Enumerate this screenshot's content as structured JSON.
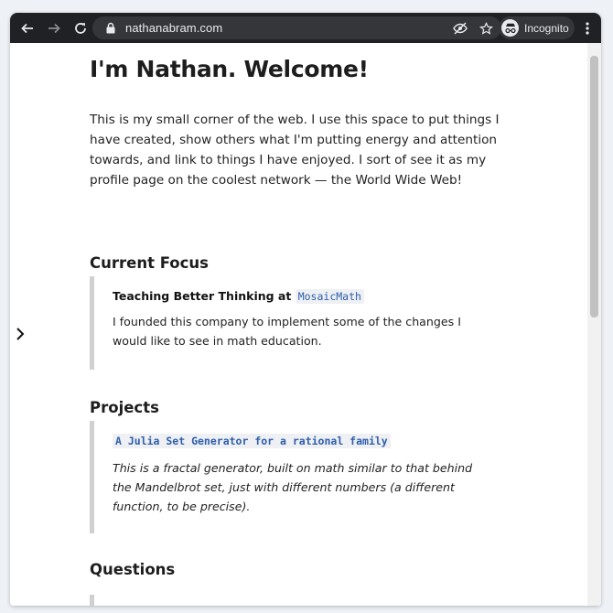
{
  "browser": {
    "url": "nathanabram.com",
    "profile_label": "Incognito"
  },
  "page": {
    "title": "I'm Nathan. Welcome!",
    "intro": "This is my small corner of the web. I use this space to put things I have created, show others what I'm putting energy and attention towards, and link to things I have enjoyed. I sort of see it as my profile page on the coolest network — the World Wide Web!",
    "current_focus": {
      "heading": "Current Focus",
      "item_title_prefix": "Teaching Better Thinking at",
      "item_link": "MosaicMath",
      "item_text": "I founded this company to implement some of the changes I would like to see in math education."
    },
    "projects": {
      "heading": "Projects",
      "item_link": "A Julia Set Generator for a rational family",
      "item_text": "This is a fractal generator, built on math similar to that behind the Mandelbrot set, just with different numbers (a different function, to be precise)."
    },
    "questions": {
      "heading": "Questions"
    }
  },
  "colors": {
    "toolbar": "#202124",
    "omnibox": "#35363a",
    "link_code": "#2e5eaa",
    "blockquote_border": "#d0d0d0"
  }
}
